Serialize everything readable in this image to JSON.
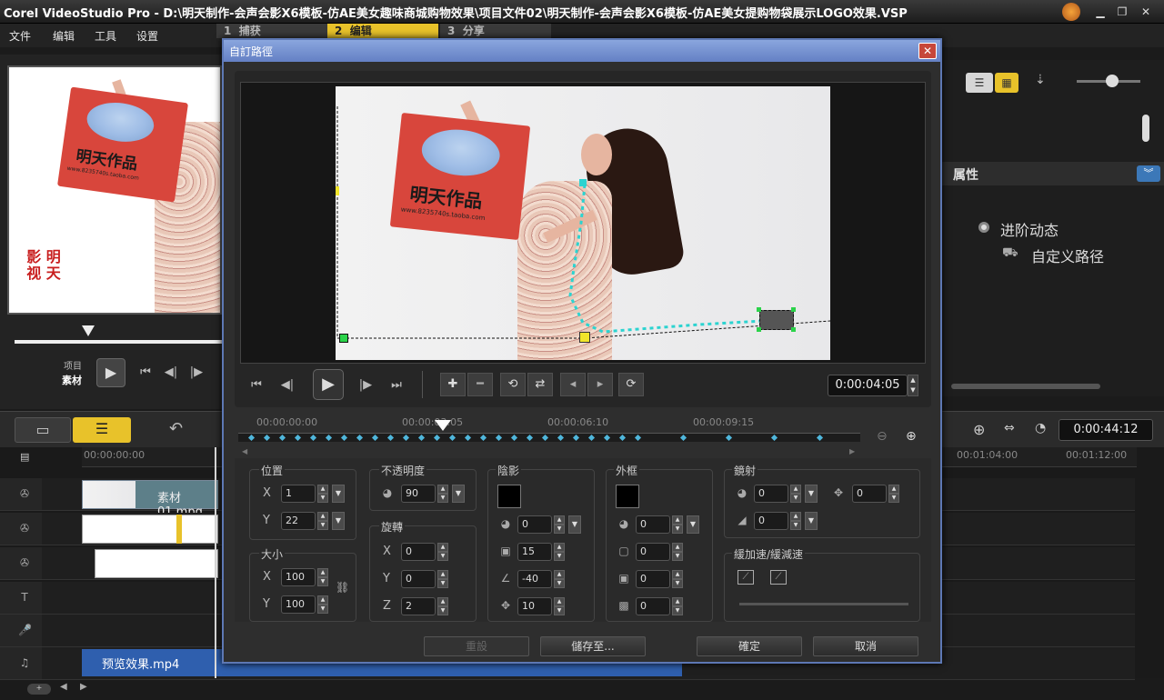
{
  "app": {
    "title": "Corel VideoStudio Pro - D:\\明天制作-会声会影X6模板-仿AE美女趣味商城购物效果\\项目文件02\\明天制作-会声会影X6模板-仿AE美女提购物袋展示LOGO效果.VSP"
  },
  "menu": {
    "items": [
      "文件",
      "编辑",
      "工具",
      "设置"
    ]
  },
  "steps": [
    {
      "num": "1",
      "label": "捕获"
    },
    {
      "num": "2",
      "label": "编辑"
    },
    {
      "num": "3",
      "label": "分享"
    }
  ],
  "preview": {
    "bag_text": "明天作品",
    "bag_url": "www.8235740s.taoba.com",
    "watermark": "影 明 视 天",
    "mode_project": "项目",
    "mode_clip": "素材"
  },
  "right_panel": {
    "attributes_label": "属性",
    "advanced_motion": "进阶动态",
    "custom_path": "自定义路径"
  },
  "timeline": {
    "timecode": "0:00:44:12",
    "ruler": [
      "00:00:00:00",
      "00:01:04:00",
      "00:01:12:00"
    ],
    "clip_video": "素材01.mpg",
    "clip_audio": "预览效果.mp4",
    "track_labels": [
      "T",
      "♫"
    ]
  },
  "dialog": {
    "title": "自訂路徑",
    "timecode": "0:00:04:05",
    "ruler": [
      "00:00:00:00",
      "00:00:03:05",
      "00:00:06:10",
      "00:00:09:15"
    ],
    "video_bag_text": "明天作品",
    "video_bag_url": "www.8235740s.taoba.com",
    "position": {
      "label": "位置",
      "x_label": "X",
      "y_label": "Y",
      "x": "1",
      "y": "22"
    },
    "size": {
      "label": "大小",
      "x_label": "X",
      "y_label": "Y",
      "x": "100",
      "y": "100"
    },
    "opacity": {
      "label": "不透明度",
      "value": "90"
    },
    "rotation": {
      "label": "旋轉",
      "x_label": "X",
      "y_label": "Y",
      "z_label": "Z",
      "x": "0",
      "y": "0",
      "z": "2"
    },
    "shadow": {
      "label": "陰影",
      "opacity": "0",
      "blur": "15",
      "angle": "-40",
      "distance": "10"
    },
    "border": {
      "label": "外框",
      "opacity": "0",
      "width": "0",
      "a": "0",
      "b": "0"
    },
    "mirror": {
      "label": "鏡射",
      "v1": "0",
      "v2": "0",
      "v3": "0"
    },
    "ease": {
      "label": "緩加速/緩減速"
    },
    "buttons": {
      "reset": "重設",
      "save_to": "儲存至...",
      "ok": "確定",
      "cancel": "取消"
    }
  },
  "colors": {
    "accent": "#e8c22a",
    "dialog_border": "#5d78b4",
    "dialog_title": "#7f9bd6",
    "path": "#2cd3d0",
    "bag": "#d8463c"
  }
}
